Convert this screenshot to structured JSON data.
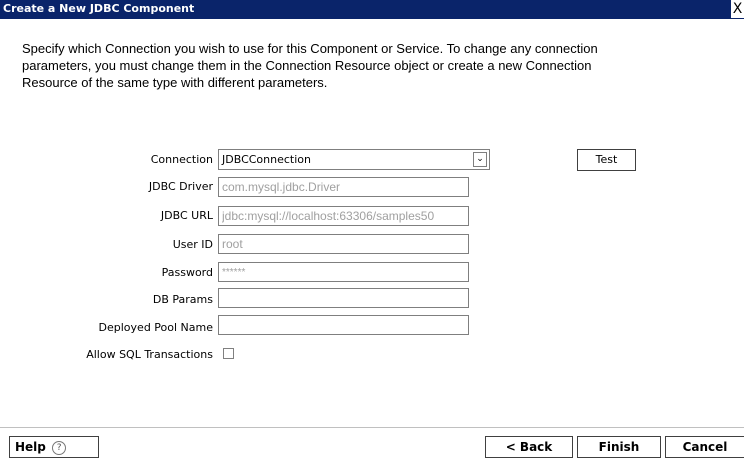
{
  "window": {
    "title": "Create a New JDBC Component",
    "close_glyph": "X"
  },
  "description": {
    "line1": "Specify which Connection you wish to use for this Component or Service.  To change any connection",
    "line2": "parameters, you must change them in the Connection Resource object or create a new Connection",
    "line3": "Resource of the same type with different parameters."
  },
  "form": {
    "connection": {
      "label": "Connection",
      "value": "JDBCConnection"
    },
    "test_button": "Test",
    "jdbc_driver": {
      "label": "JDBC Driver",
      "value": "com.mysql.jdbc.Driver"
    },
    "jdbc_url": {
      "label": "JDBC URL",
      "value": "jdbc:mysql://localhost:63306/samples50"
    },
    "user_id": {
      "label": "User ID",
      "value": "root"
    },
    "password": {
      "label": "Password",
      "value": "******"
    },
    "db_params": {
      "label": "DB Params",
      "value": ""
    },
    "deployed_pool_name": {
      "label": "Deployed Pool Name",
      "value": ""
    },
    "allow_sql_transactions": {
      "label": "Allow SQL Transactions",
      "checked": false
    }
  },
  "footer": {
    "help": "Help",
    "help_icon": "question-mark-icon",
    "help_glyph": "?",
    "back": "< Back",
    "finish": "Finish",
    "cancel": "Cancel"
  }
}
